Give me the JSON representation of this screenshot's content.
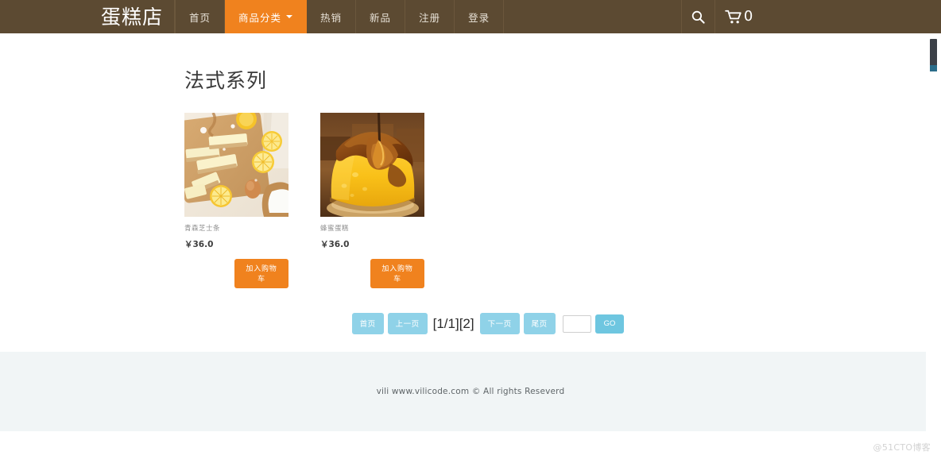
{
  "navbar": {
    "brand": "蛋糕店",
    "items": [
      {
        "label": "首页",
        "active": false
      },
      {
        "label": "商品分类",
        "active": true,
        "caret": true
      },
      {
        "label": "热销",
        "active": false
      },
      {
        "label": "新品",
        "active": false
      },
      {
        "label": "注册",
        "active": false
      },
      {
        "label": "登录",
        "active": false
      }
    ],
    "search_icon": "search-icon",
    "cart_icon": "shopping-cart-icon",
    "cart_count": "0",
    "background_color": "#5c4a32",
    "active_color": "#f0821e"
  },
  "main": {
    "page_title": "法式系列",
    "products": [
      {
        "name": "青森芝士条",
        "price": "￥36.0",
        "button_label": "加入购物车",
        "image_alt": "lemon-cheese-bars-on-wooden-board"
      },
      {
        "name": "蜂蜜蛋糕",
        "price": "￥36.0",
        "button_label": "加入购物车",
        "image_alt": "honey-cake-slice-with-syrup"
      }
    ]
  },
  "pagination": {
    "first_label": "首页",
    "prev_label": "上一页",
    "info": "[1/1][2]",
    "next_label": "下一页",
    "last_label": "尾页",
    "input_value": "",
    "input_placeholder": "",
    "go_label": "GO",
    "button_color": "#8fd2e8",
    "go_color": "#6ec6e0"
  },
  "footer": {
    "text": "vili www.vilicode.com © All rights Reseverd",
    "background_color": "#f1f5f6"
  },
  "watermark": {
    "text": "@51CTO博客"
  }
}
